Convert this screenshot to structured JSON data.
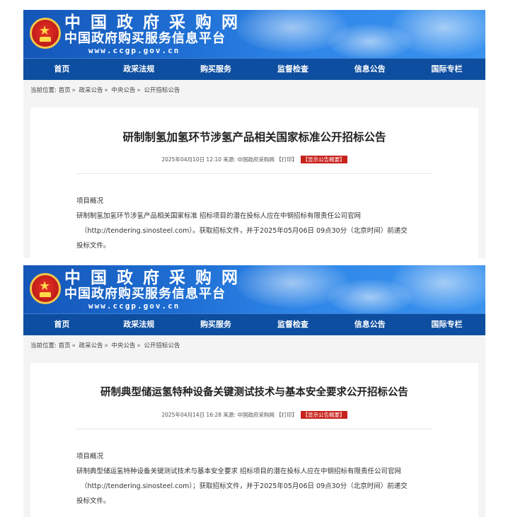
{
  "site": {
    "logo_line1": "中国政府采购网",
    "logo_line2": "中国政府购买服务信息平台",
    "logo_url": "www.ccgp.gov.cn"
  },
  "nav": [
    "首页",
    "政采法规",
    "购买服务",
    "监督检查",
    "信息公告",
    "国际专栏"
  ],
  "breadcrumb": {
    "label": "当前位置:",
    "items": [
      "首页",
      "政采公告",
      "中央公告",
      "公开招标公告"
    ],
    "separator": "»"
  },
  "notices": [
    {
      "title": "研制制氢加氢环节涉氢产品相关国家标准公开招标公告",
      "datetime": "2025年04月10日 12:10",
      "source": "来源: 中国政府采购网",
      "print": "【打印】",
      "summary_btn": "【显示公告概要】",
      "section": "项目概况",
      "line1": "研制制氢加氢环节涉氢产品相关国家标准 招标项目的潜在投标人应在中钢招标有限责任公司官网",
      "line2": "（http://tendering.sinosteel.com）。获取招标文件，并于2025年05月06日 09点30分（北京时间）前递交",
      "line3": "投标文件。"
    },
    {
      "title": "研制典型储运氢特种设备关键测试技术与基本安全要求公开招标公告",
      "datetime": "2025年04月14日 16:28",
      "source": "来源: 中国政府采购网",
      "print": "【打印】",
      "summary_btn": "【显示公告概要】",
      "section": "项目概况",
      "line1": "研制典型储运氢特种设备关键测试技术与基本安全要求 招标项目的潜在投标人应在中钢招标有限责任公司官网",
      "line2": "（http://tendering.sinosteel.com）；获取招标文件，并于2025年05月06日 09点30分（北京时间）前递交",
      "line3": "投标文件。"
    }
  ],
  "colors": {
    "banner": "#1f6fd4",
    "nav": "#0e4ea0",
    "summary_btn": "#c8221c"
  }
}
